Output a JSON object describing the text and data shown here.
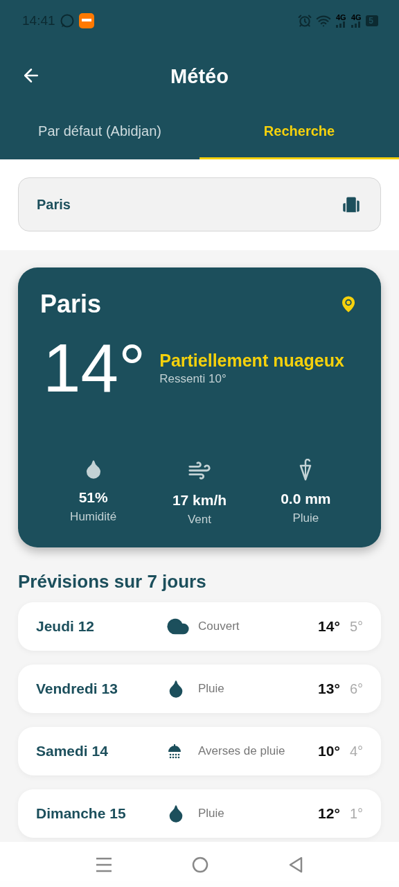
{
  "status_bar": {
    "time": "14:41",
    "networks": [
      "4G",
      "4G"
    ],
    "battery": "5"
  },
  "header": {
    "title": "Météo"
  },
  "tabs": [
    {
      "label": "Par défaut (Abidjan)",
      "selected": false
    },
    {
      "label": "Recherche",
      "selected": true
    }
  ],
  "search": {
    "value": "Paris"
  },
  "current": {
    "city": "Paris",
    "temperature": "14°",
    "condition": "Partiellement nuageux",
    "feels_like": "Ressenti 10°",
    "stats": [
      {
        "kind": "humidity",
        "value": "51%",
        "label": "Humidité"
      },
      {
        "kind": "wind",
        "value": "17 km/h",
        "label": "Vent"
      },
      {
        "kind": "rain",
        "value": "0.0 mm",
        "label": "Pluie"
      }
    ]
  },
  "forecast": {
    "title": "Prévisions sur 7 jours",
    "days": [
      {
        "day": "Jeudi 12",
        "kind": "cloud",
        "condition": "Couvert",
        "high": "14°",
        "low": "5°"
      },
      {
        "day": "Vendredi 13",
        "kind": "rain",
        "condition": "Pluie",
        "high": "13°",
        "low": "6°"
      },
      {
        "day": "Samedi 14",
        "kind": "showers",
        "condition": "Averses de pluie",
        "high": "10°",
        "low": "4°"
      },
      {
        "day": "Dimanche 15",
        "kind": "rain",
        "condition": "Pluie",
        "high": "12°",
        "low": "1°"
      }
    ]
  }
}
